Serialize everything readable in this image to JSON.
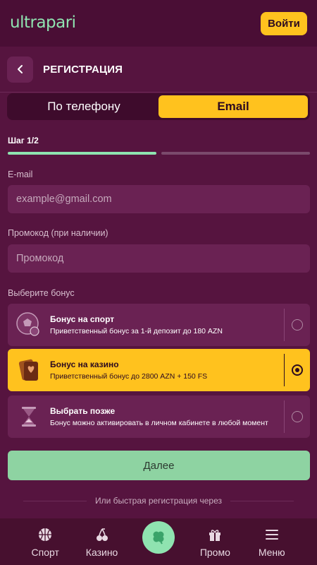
{
  "header": {
    "logo": "ultrapari",
    "login_label": "Войти"
  },
  "registration": {
    "title": "РЕГИСТРАЦИЯ",
    "tabs": [
      {
        "label": "По телефону"
      },
      {
        "label": "Email"
      }
    ],
    "active_tab": "Email",
    "step": "Шаг 1/2",
    "progress_fraction": 0.5,
    "email": {
      "label": "E-mail",
      "placeholder": "example@gmail.com",
      "value": ""
    },
    "promo": {
      "label": "Промокод (при наличии)",
      "placeholder": "Промокод",
      "value": ""
    },
    "bonus_label": "Выберите бонус",
    "bonuses": [
      {
        "title": "Бонус на спорт",
        "desc": "Приветственный бонус за 1-й депозит до 180 AZN",
        "icon": "soccer-ball-icon",
        "selected": false
      },
      {
        "title": "Бонус на казино",
        "desc": "Приветственный бонус до 2800 AZN + 150 FS",
        "icon": "playing-cards-icon",
        "selected": true
      },
      {
        "title": "Выбрать позже",
        "desc": "Бонус можно активировать в личном кабинете в любой момент",
        "icon": "hourglass-icon",
        "selected": false
      }
    ],
    "next_label": "Далее",
    "quick_reg": "Или быстрая регистрация через"
  },
  "nav": {
    "items": [
      {
        "label": "Спорт",
        "icon": "basketball-icon"
      },
      {
        "label": "Казино",
        "icon": "cherries-icon"
      },
      {
        "label": "",
        "icon": "clover-icon"
      },
      {
        "label": "Промо",
        "icon": "gift-icon"
      },
      {
        "label": "Меню",
        "icon": "hamburger-menu-icon"
      }
    ]
  },
  "colors": {
    "background": "#4a0e35",
    "panel": "#56143f",
    "accent": "#ffc21e",
    "green": "#8fe3b0"
  }
}
